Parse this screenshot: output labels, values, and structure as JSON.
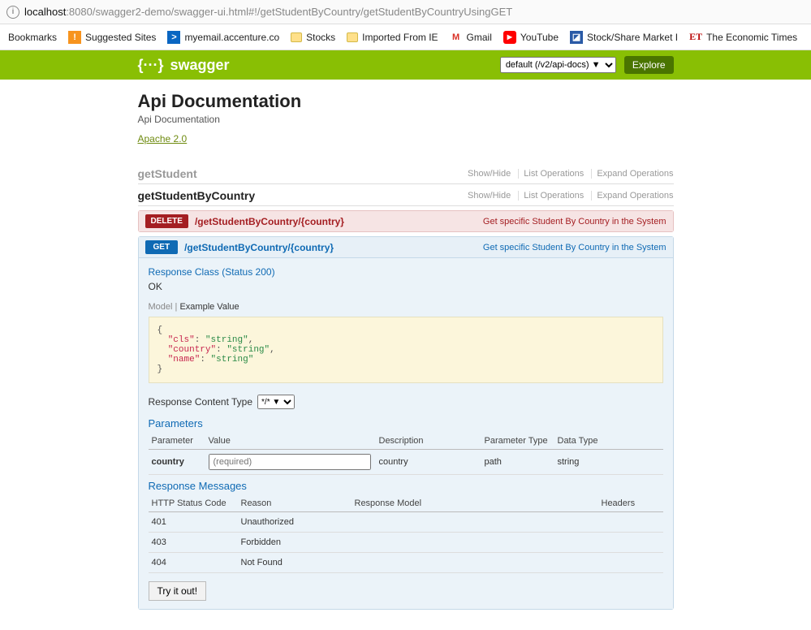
{
  "browser": {
    "url_host": "localhost",
    "url_rest": ":8080/swagger2-demo/swagger-ui.html#!/getStudentByCountry/getStudentByCountryUsingGET",
    "bookmarks_label": "Bookmarks",
    "bookmarks": [
      {
        "label": "Suggested Sites",
        "icon": "orange"
      },
      {
        "label": "myemail.accenture.co",
        "icon": "blue"
      },
      {
        "label": "Stocks",
        "icon": "folder"
      },
      {
        "label": "Imported From IE",
        "icon": "folder"
      },
      {
        "label": "Gmail",
        "icon": "gmail"
      },
      {
        "label": "YouTube",
        "icon": "yt"
      },
      {
        "label": "Stock/Share Market I",
        "icon": "stock"
      },
      {
        "label": "The Economic Times",
        "icon": "et"
      }
    ]
  },
  "header": {
    "brand": "swagger",
    "spec_select": "default (/v2/api-docs) ▼",
    "explore": "Explore"
  },
  "info": {
    "title": "Api Documentation",
    "description": "Api Documentation",
    "license_name": "Apache 2.0"
  },
  "controllers": [
    {
      "name": "getStudent",
      "active": false
    },
    {
      "name": "getStudentByCountry",
      "active": true
    }
  ],
  "controller_ops": {
    "show": "Show/Hide",
    "list": "List Operations",
    "expand": "Expand Operations"
  },
  "ops": [
    {
      "method": "DELETE",
      "path": "/getStudentByCountry/{country}",
      "summary": "Get specific Student By Country in the System"
    },
    {
      "method": "GET",
      "path": "/getStudentByCountry/{country}",
      "summary": "Get specific Student By Country in the System"
    }
  ],
  "detail": {
    "response_class": "Response Class (Status 200)",
    "ok_text": "OK",
    "tabs": {
      "model": "Model",
      "example": "Example Value"
    },
    "rct_label": "Response Content Type",
    "rct_value": "*/* ▼",
    "parameters_heading": "Parameters",
    "param_headers": {
      "p": "Parameter",
      "v": "Value",
      "d": "Description",
      "pt": "Parameter Type",
      "dt": "Data Type"
    },
    "param_row": {
      "name": "country",
      "placeholder": "(required)",
      "desc": "country",
      "ptype": "path",
      "dtype": "string"
    },
    "resp_heading": "Response Messages",
    "resp_headers": {
      "code": "HTTP Status Code",
      "reason": "Reason",
      "model": "Response Model",
      "headers": "Headers"
    },
    "resp_rows": [
      {
        "code": "401",
        "reason": "Unauthorized"
      },
      {
        "code": "403",
        "reason": "Forbidden"
      },
      {
        "code": "404",
        "reason": "Not Found"
      }
    ],
    "try_label": "Try it out!"
  }
}
